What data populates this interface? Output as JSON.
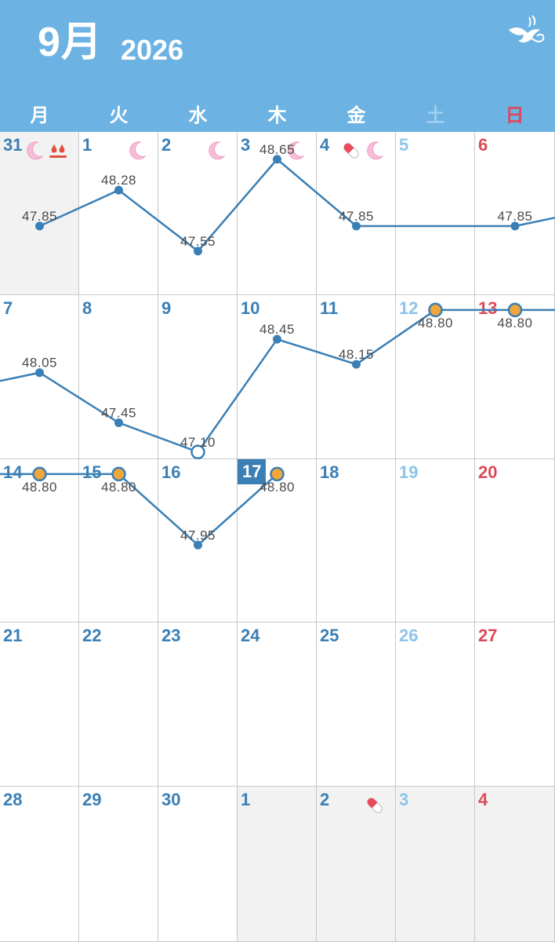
{
  "header": {
    "month": "9月",
    "year": "2026"
  },
  "weekdays": [
    {
      "label": "月",
      "type": "weekday"
    },
    {
      "label": "火",
      "type": "weekday"
    },
    {
      "label": "水",
      "type": "weekday"
    },
    {
      "label": "木",
      "type": "weekday"
    },
    {
      "label": "金",
      "type": "weekday"
    },
    {
      "label": "土",
      "type": "sat"
    },
    {
      "label": "日",
      "type": "sun"
    }
  ],
  "weeks": [
    [
      {
        "day": "31",
        "grey": true,
        "icons": [
          "moon-icon",
          "drops-icon"
        ]
      },
      {
        "day": "1",
        "icons": [
          "moon-icon"
        ]
      },
      {
        "day": "2",
        "icons": [
          "moon-icon"
        ]
      },
      {
        "day": "3",
        "icons": [
          "moon-icon"
        ]
      },
      {
        "day": "4",
        "icons": [
          "pill-icon",
          "moon-icon"
        ]
      },
      {
        "day": "5",
        "icons": []
      },
      {
        "day": "6",
        "icons": []
      }
    ],
    [
      {
        "day": "7",
        "icons": []
      },
      {
        "day": "8",
        "icons": []
      },
      {
        "day": "9",
        "icons": []
      },
      {
        "day": "10",
        "icons": []
      },
      {
        "day": "11",
        "icons": []
      },
      {
        "day": "12",
        "icons": []
      },
      {
        "day": "13",
        "icons": []
      }
    ],
    [
      {
        "day": "14",
        "icons": []
      },
      {
        "day": "15",
        "icons": []
      },
      {
        "day": "16",
        "icons": []
      },
      {
        "day": "17",
        "today": true,
        "icons": []
      },
      {
        "day": "18",
        "icons": []
      },
      {
        "day": "19",
        "icons": []
      },
      {
        "day": "20",
        "icons": []
      }
    ],
    [
      {
        "day": "21",
        "icons": []
      },
      {
        "day": "22",
        "icons": []
      },
      {
        "day": "23",
        "icons": []
      },
      {
        "day": "24",
        "icons": []
      },
      {
        "day": "25",
        "icons": []
      },
      {
        "day": "26",
        "icons": []
      },
      {
        "day": "27",
        "icons": []
      }
    ],
    [
      {
        "day": "28",
        "icons": []
      },
      {
        "day": "29",
        "icons": []
      },
      {
        "day": "30",
        "icons": []
      },
      {
        "day": "1",
        "grey": true,
        "icons": []
      },
      {
        "day": "2",
        "grey": true,
        "icons": [
          "pill-icon"
        ]
      },
      {
        "day": "3",
        "grey": true,
        "icons": []
      },
      {
        "day": "4",
        "grey": true,
        "icons": []
      }
    ]
  ],
  "chart_data": {
    "type": "line",
    "series": [
      {
        "points": [
          {
            "week": 0,
            "weekday": 0,
            "value": 47.85,
            "label": "47.85",
            "marker": "dot"
          },
          {
            "week": 0,
            "weekday": 1,
            "value": 48.28,
            "label": "48.28",
            "marker": "dot"
          },
          {
            "week": 0,
            "weekday": 2,
            "value": 47.55,
            "label": "47.55",
            "marker": "dot"
          },
          {
            "week": 0,
            "weekday": 3,
            "value": 48.65,
            "label": "48.65",
            "marker": "dot"
          },
          {
            "week": 0,
            "weekday": 4,
            "value": 47.85,
            "label": "47.85",
            "marker": "dot"
          },
          {
            "week": 0,
            "weekday": 6,
            "value": 47.85,
            "label": "47.85",
            "marker": "dot"
          },
          {
            "week": 1,
            "weekday": 0,
            "value": 48.05,
            "label": "48.05",
            "marker": "dot"
          },
          {
            "week": 1,
            "weekday": 1,
            "value": 47.45,
            "label": "47.45",
            "marker": "dot"
          },
          {
            "week": 1,
            "weekday": 2,
            "value": 47.1,
            "label": "47.10",
            "marker": "open"
          },
          {
            "week": 1,
            "weekday": 3,
            "value": 48.45,
            "label": "48.45",
            "marker": "dot"
          },
          {
            "week": 1,
            "weekday": 4,
            "value": 48.15,
            "label": "48.15",
            "marker": "dot"
          },
          {
            "week": 1,
            "weekday": 5,
            "value": 48.8,
            "label": "48.80",
            "marker": "orange"
          },
          {
            "week": 1,
            "weekday": 6,
            "value": 48.8,
            "label": "48.80",
            "marker": "orange"
          },
          {
            "week": 2,
            "weekday": 0,
            "value": 48.8,
            "label": "48.80",
            "marker": "orange"
          },
          {
            "week": 2,
            "weekday": 1,
            "value": 48.8,
            "label": "48.80",
            "marker": "orange"
          },
          {
            "week": 2,
            "weekday": 2,
            "value": 47.95,
            "label": "47.95",
            "marker": "dot"
          },
          {
            "week": 2,
            "weekday": 3,
            "value": 48.8,
            "label": "48.80",
            "marker": "orange"
          }
        ]
      }
    ],
    "line_color": "#3a7fb5",
    "orange_color": "#f0a63a"
  },
  "colors": {
    "header": "#6cb2e2",
    "weekday_num": "#3a7fb5",
    "sat_num": "#8cc4ea",
    "sun_num": "#dc4b57"
  }
}
